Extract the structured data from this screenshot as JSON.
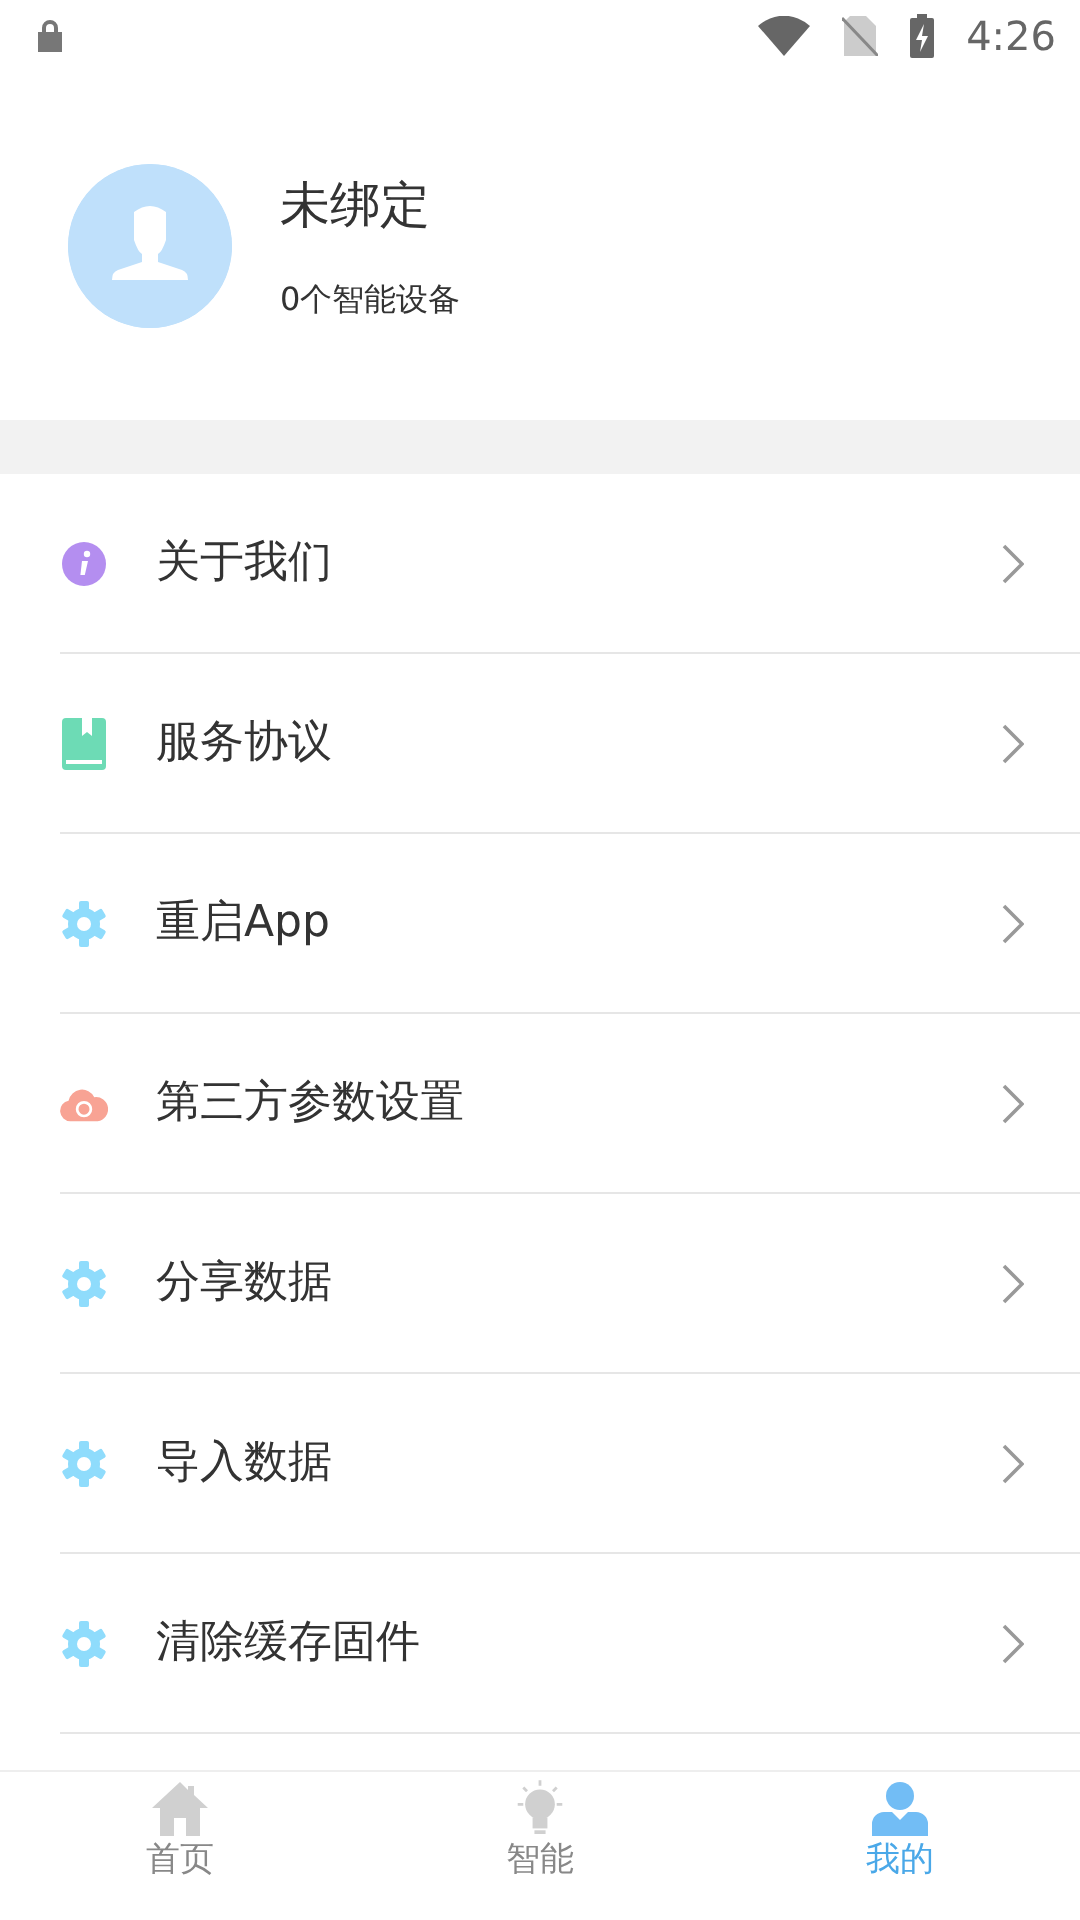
{
  "status_bar": {
    "time": "4:26"
  },
  "profile": {
    "name": "未绑定",
    "devices": "0个智能设备"
  },
  "menu": [
    {
      "label": "关于我们",
      "kind": "info"
    },
    {
      "label": "服务协议",
      "kind": "book"
    },
    {
      "label": "重启App",
      "kind": "gear"
    },
    {
      "label": "第三方参数设置",
      "kind": "cloud"
    },
    {
      "label": "分享数据",
      "kind": "gear"
    },
    {
      "label": "导入数据",
      "kind": "gear"
    },
    {
      "label": "清除缓存固件",
      "kind": "gear"
    }
  ],
  "tabs": [
    {
      "label": "首页",
      "kind": "home",
      "selected": false
    },
    {
      "label": "智能",
      "kind": "bulb",
      "selected": false
    },
    {
      "label": "我的",
      "kind": "person",
      "selected": true
    }
  ]
}
